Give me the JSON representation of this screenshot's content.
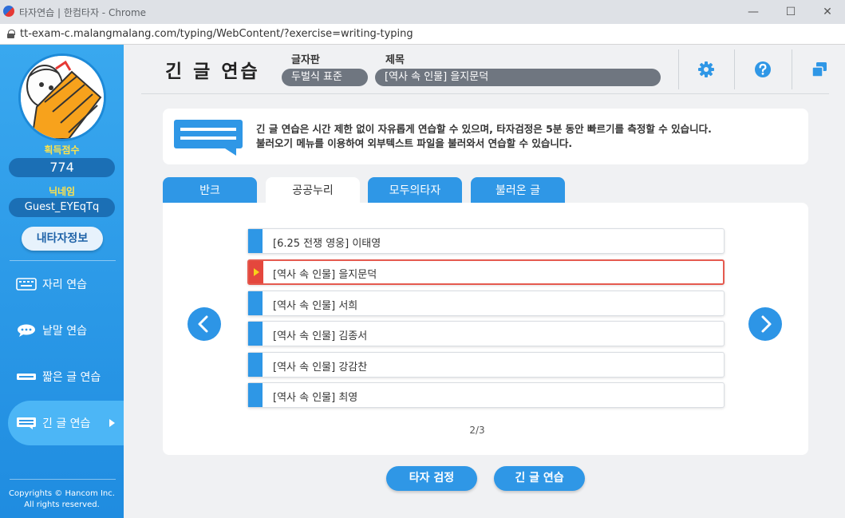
{
  "browser": {
    "title": "타자연습 | 한컴타자 - Chrome",
    "url": "tt-exam-c.malangmalang.com/typing/WebContent/?exercise=writing-typing",
    "minimize": "—",
    "maximize": "☐",
    "close": "✕"
  },
  "sidebar": {
    "score_label": "획득점수",
    "score_value": "774",
    "nickname_label": "닉네임",
    "nickname_value": "Guest_EYEqTq",
    "my_info_button": "내타자정보",
    "menu": [
      {
        "label": "자리 연습",
        "icon": "keyboard-icon"
      },
      {
        "label": "낱말 연습",
        "icon": "speech-bubble-icon"
      },
      {
        "label": "짧은 글 연습",
        "icon": "short-text-icon"
      },
      {
        "label": "긴 글 연습",
        "icon": "long-text-icon",
        "active": true
      }
    ],
    "copyright_line1": "Copyrights © Hancom Inc.",
    "copyright_line2": "All rights reserved."
  },
  "header": {
    "title": "긴 글 연습",
    "keyboard_label": "글자판",
    "keyboard_value": "두벌식 표준",
    "subject_label": "제목",
    "subject_value": "[역사 속 인물] 을지문덕",
    "icons": [
      "gear-icon",
      "help-icon",
      "window-icon"
    ]
  },
  "info": {
    "line1": "긴 글 연습은 시간 제한 없이 자유롭게 연습할 수 있으며, 타자검정은 5분 동안 빠르기를 측정할 수 있습니다.",
    "line2": "불러오기 메뉴를 이용하여 외부텍스트 파일을 불러와서 연습할 수 있습니다."
  },
  "tabs": [
    "반크",
    "공공누리",
    "모두의타자",
    "불러온 글"
  ],
  "active_tab": "공공누리",
  "list": [
    "[6.25 전쟁 영웅] 이태영",
    "[역사 속 인물] 을지문덕",
    "[역사 속 인물] 서희",
    "[역사 속 인물] 김종서",
    "[역사 속 인물] 강감찬",
    "[역사 속 인물] 최영"
  ],
  "selected_index": 1,
  "pager": "2/3",
  "buttons": {
    "typing_test": "타자 검정",
    "long_practice": "긴 글 연습"
  },
  "colors": {
    "primary": "#2f97e6",
    "selected_border": "#e55a4f",
    "score_label": "#ffe24a"
  }
}
